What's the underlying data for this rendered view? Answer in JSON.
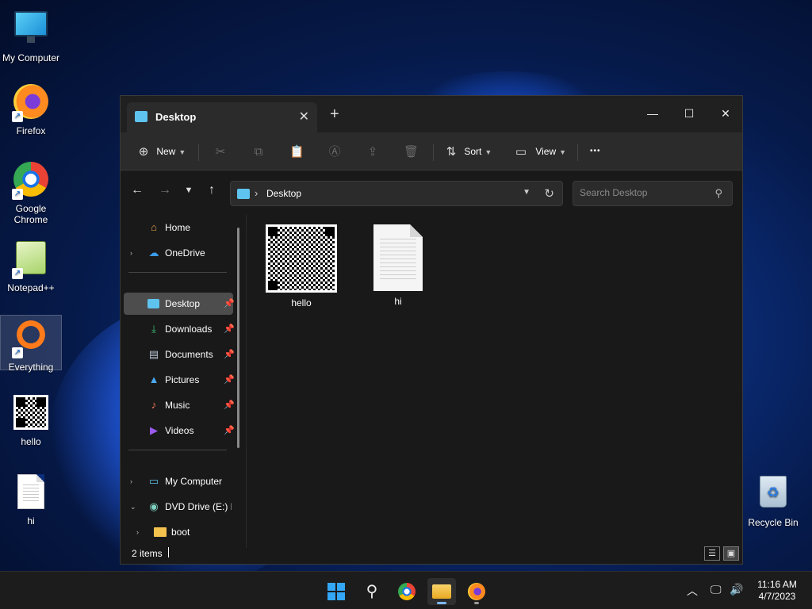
{
  "desktop": {
    "icons": [
      {
        "label": "My Computer"
      },
      {
        "label": "Firefox"
      },
      {
        "label": "Google Chrome"
      },
      {
        "label": "Notepad++"
      },
      {
        "label": "Everything"
      },
      {
        "label": "hello"
      },
      {
        "label": "hi"
      },
      {
        "label": "Recycle Bin"
      }
    ]
  },
  "explorer": {
    "tab_title": "Desktop",
    "toolbar": {
      "new_label": "New",
      "sort_label": "Sort",
      "view_label": "View",
      "more_label": "•••"
    },
    "address": {
      "path": "Desktop"
    },
    "search": {
      "placeholder": "Search Desktop"
    },
    "nav": {
      "items": [
        {
          "label": "Home"
        },
        {
          "label": "OneDrive"
        },
        {
          "label": "Desktop"
        },
        {
          "label": "Downloads"
        },
        {
          "label": "Documents"
        },
        {
          "label": "Pictures"
        },
        {
          "label": "Music"
        },
        {
          "label": "Videos"
        },
        {
          "label": "My Computer"
        },
        {
          "label": "DVD Drive (E:) ESD-ISO"
        },
        {
          "label": "boot"
        }
      ]
    },
    "files": [
      {
        "name": "hello"
      },
      {
        "name": "hi"
      }
    ],
    "status": {
      "item_count": "2 items"
    }
  },
  "taskbar": {
    "clock_time": "11:16 AM",
    "clock_date": "4/7/2023"
  },
  "colors": {
    "accent": "#5ec3ee",
    "selection": "#4d4d4d",
    "taskbar_indicator": "#7fb8ff"
  }
}
